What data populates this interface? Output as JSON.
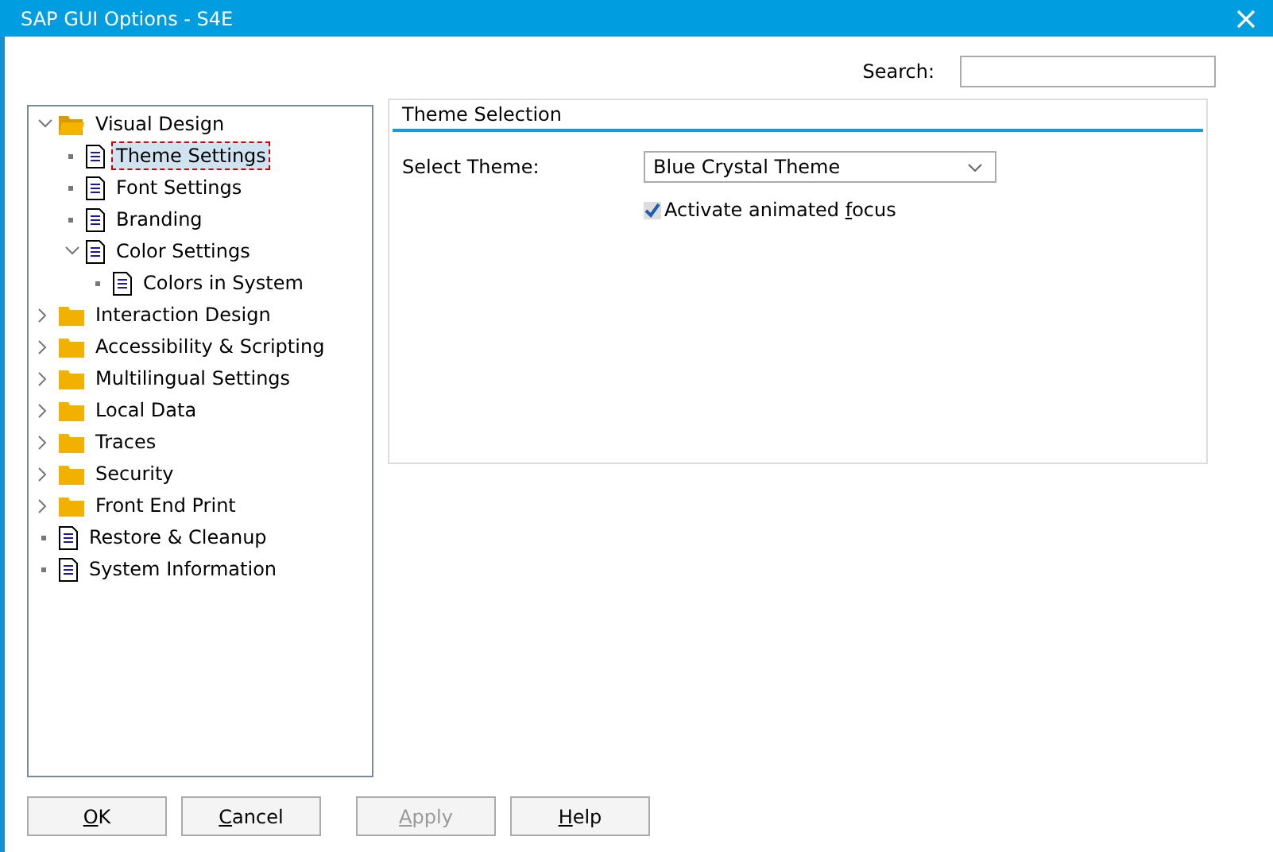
{
  "window": {
    "title": "SAP GUI Options - S4E"
  },
  "search": {
    "label": "Search:"
  },
  "tree": [
    {
      "label": "Visual Design",
      "kind": "folder",
      "expanded": true,
      "selected": false,
      "children": [
        {
          "label": "Theme Settings",
          "kind": "document",
          "selected": true
        },
        {
          "label": "Font Settings",
          "kind": "document",
          "selected": false
        },
        {
          "label": "Branding",
          "kind": "document",
          "selected": false
        },
        {
          "label": "Color Settings",
          "kind": "document",
          "expanded": true,
          "selected": false,
          "children": [
            {
              "label": "Colors in System",
              "kind": "document",
              "selected": false
            }
          ]
        }
      ]
    },
    {
      "label": "Interaction Design",
      "kind": "folder",
      "expanded": false,
      "selected": false
    },
    {
      "label": "Accessibility & Scripting",
      "kind": "folder",
      "expanded": false,
      "selected": false
    },
    {
      "label": "Multilingual Settings",
      "kind": "folder",
      "expanded": false,
      "selected": false
    },
    {
      "label": "Local Data",
      "kind": "folder",
      "expanded": false,
      "selected": false
    },
    {
      "label": "Traces",
      "kind": "folder",
      "expanded": false,
      "selected": false
    },
    {
      "label": "Security",
      "kind": "folder",
      "expanded": false,
      "selected": false
    },
    {
      "label": "Front End Print",
      "kind": "folder",
      "expanded": false,
      "selected": false
    },
    {
      "label": "Restore & Cleanup",
      "kind": "document",
      "selected": false
    },
    {
      "label": "System Information",
      "kind": "document",
      "selected": false
    }
  ],
  "panel": {
    "title": "Theme Selection",
    "theme_label": "Select Theme:",
    "theme_value": "Blue Crystal Theme",
    "checkbox": {
      "label_before": "Activate animated ",
      "access_key": "f",
      "label_after": "ocus",
      "checked": true
    }
  },
  "buttons": [
    {
      "access_key": "O",
      "label_after": "K",
      "disabled": false
    },
    {
      "access_key": "C",
      "label_after": "ancel",
      "disabled": false
    },
    {
      "access_key": "A",
      "label_after": "pply",
      "disabled": true
    },
    {
      "access_key": "H",
      "label_after": "elp",
      "disabled": false
    }
  ]
}
